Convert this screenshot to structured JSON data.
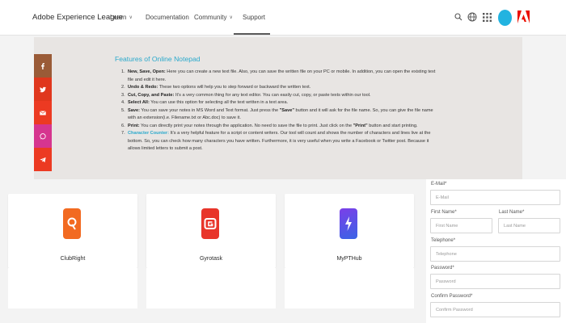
{
  "nav": {
    "brand": "Adobe Experience League",
    "items": [
      {
        "label": "Learn",
        "dropdown": true
      },
      {
        "label": "Documentation",
        "dropdown": false
      },
      {
        "label": "Community",
        "dropdown": true
      },
      {
        "label": "Support",
        "dropdown": false,
        "active": true
      }
    ],
    "icons": [
      "search-icon",
      "globe-icon",
      "apps-grid-icon",
      "avatar",
      "adobe-logo-icon"
    ]
  },
  "content": {
    "title": "Features of Online Notepad",
    "features": [
      {
        "num": "1.",
        "bold": "New, Save, Open:",
        "text": " Here you can create a new text file. Also, you can save the written file on your PC or mobile. In addition, you can open the existing text file and edit it here."
      },
      {
        "num": "2.",
        "bold": "Undo & Redo:",
        "text": " These two options will help you to step forward or backward the written text."
      },
      {
        "num": "3.",
        "bold": "Cut, Copy, and Paste:",
        "text": " It's a very common thing for any text editor. You can easily cut, copy, or paste texts within our tool."
      },
      {
        "num": "4.",
        "bold": "Select All:",
        "text": " You can use this option for selecting all the text written in a text area."
      },
      {
        "num": "5.",
        "bold": "Save:",
        "text": " You can save your notes in MS Word and Text format. Just press the ",
        "bold2": "\"Save\"",
        "text2": " button and it will ask for the file name. So, you can give the file name with an extension(i.e. Filename.txt or Abc.doc) to save it."
      },
      {
        "num": "6.",
        "bold": "Print:",
        "text": " You can directly print your notes through the application. No need to save the file to print. Just click on the ",
        "bold2": "\"Print\"",
        "text2": " button and start printing."
      },
      {
        "num": "7.",
        "blue": "Character Counter:",
        "text": " It's a very helpful feature for a script or content writers. Our tool will count and shows the number of characters and lines live at the bottom. So, you can check how many characters you have written. Furthermore, it is very useful when you write a Facebook or Twitter post. Because it allows limited letters to submit a post."
      }
    ]
  },
  "share": [
    {
      "name": "facebook",
      "glyph": "f",
      "color": "#9a5b37"
    },
    {
      "name": "twitter",
      "glyph": "t",
      "color": "#e0371d"
    },
    {
      "name": "email",
      "glyph": "m",
      "color": "#ec3a22"
    },
    {
      "name": "whatsapp",
      "glyph": "w",
      "color": "#d6358f"
    },
    {
      "name": "telegram",
      "glyph": "p",
      "color": "#ec3a22"
    }
  ],
  "cards": [
    {
      "label": "ClubRight",
      "color": "#f26a21"
    },
    {
      "label": "Gyrotask",
      "color": "#e8352a"
    },
    {
      "label": "MyPTHub",
      "color": "#5b3be0"
    }
  ],
  "form": {
    "email_label": "E-Mail*",
    "email_placeholder": "E-Mail",
    "first_label": "First Name*",
    "first_placeholder": "First Name",
    "last_label": "Last Name*",
    "last_placeholder": "Last Name",
    "phone_label": "Telephone*",
    "phone_placeholder": "Telephone",
    "password_label": "Password*",
    "password_placeholder": "Password",
    "confirm_label": "Confirm Password*",
    "confirm_placeholder": "Confirm Password"
  }
}
